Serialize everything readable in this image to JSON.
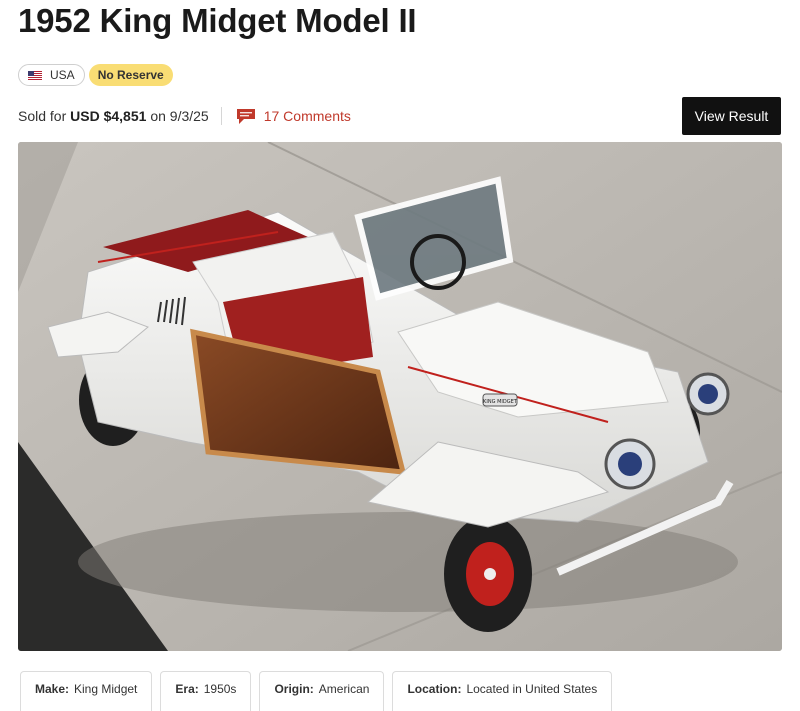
{
  "listing": {
    "title": "1952 King Midget Model II",
    "country": "USA",
    "reserve": "No Reserve",
    "sold_prefix": "Sold for",
    "price": "USD $4,851",
    "date_prefix": "on",
    "date": "9/3/25",
    "comments": "17 Comments",
    "view_result": "View Result"
  },
  "photo": {
    "badge_text": "KING MIDGET"
  },
  "specs": [
    {
      "key": "Make:",
      "value": "King Midget"
    },
    {
      "key": "Era:",
      "value": "1950s"
    },
    {
      "key": "Origin:",
      "value": "American"
    },
    {
      "key": "Location:",
      "value": "Located in United States"
    }
  ],
  "colors": {
    "accent_red": "#c0392b",
    "reserve_yellow": "#f9dd74",
    "button_black": "#111111"
  }
}
